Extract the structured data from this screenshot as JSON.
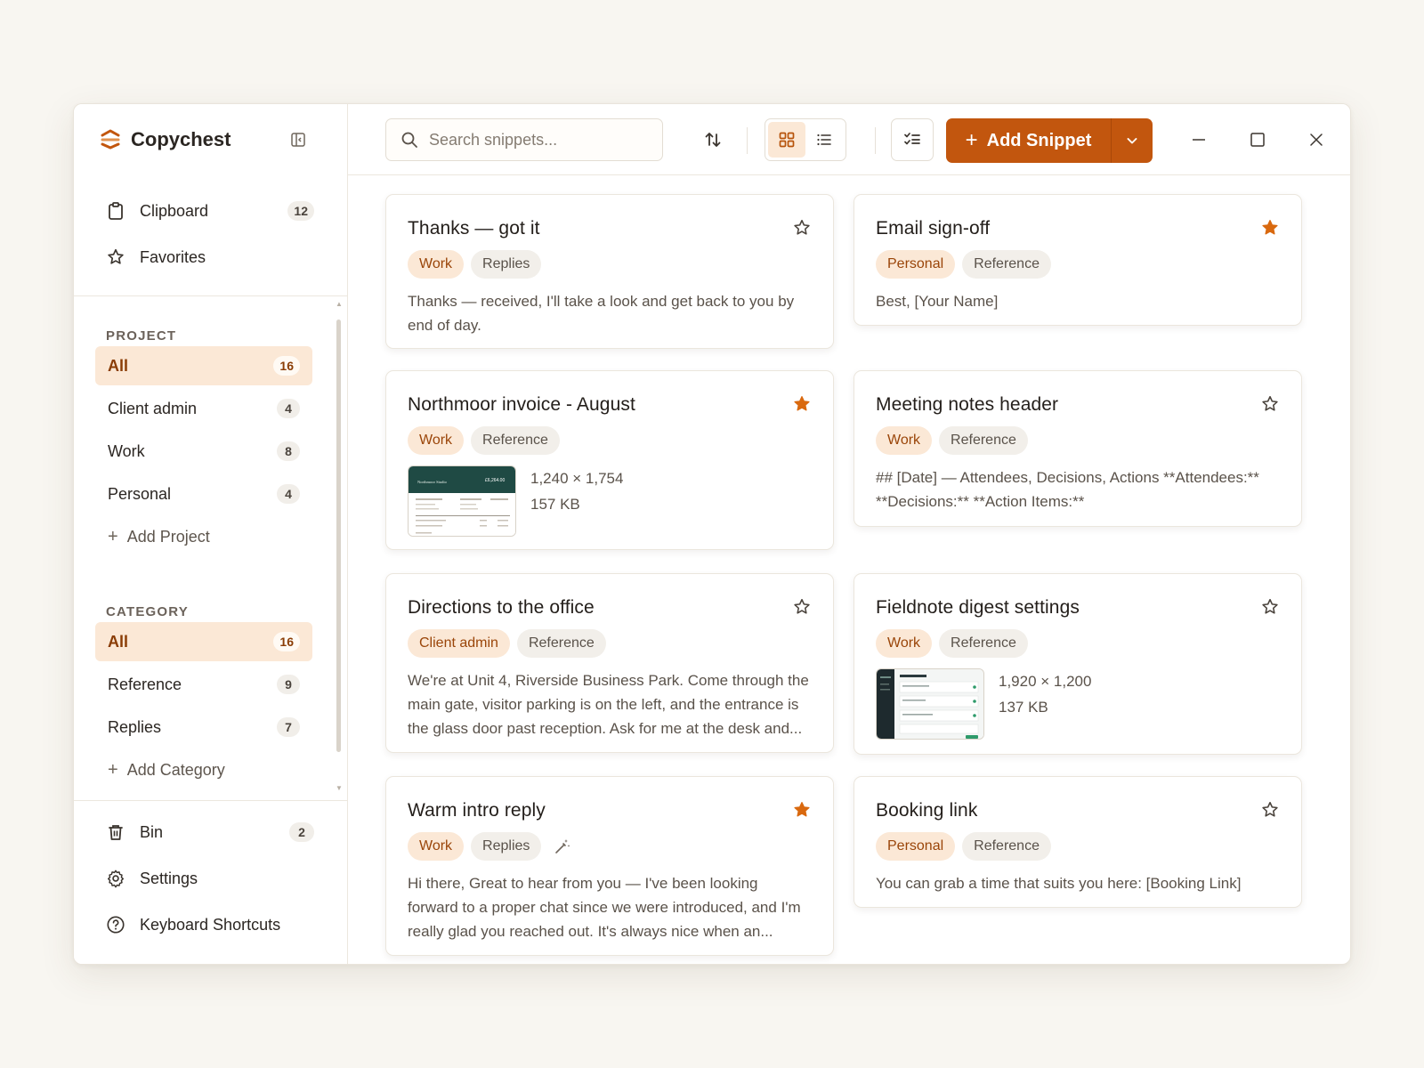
{
  "app": {
    "name": "Copychest"
  },
  "nav": {
    "clipboard": {
      "label": "Clipboard",
      "count": "12"
    },
    "favorites": {
      "label": "Favorites"
    }
  },
  "project": {
    "heading": "PROJECT",
    "items": [
      {
        "label": "All",
        "count": "16",
        "active": true
      },
      {
        "label": "Client admin",
        "count": "4"
      },
      {
        "label": "Work",
        "count": "8"
      },
      {
        "label": "Personal",
        "count": "4"
      }
    ],
    "add_label": "Add Project"
  },
  "category": {
    "heading": "CATEGORY",
    "items": [
      {
        "label": "All",
        "count": "16",
        "active": true
      },
      {
        "label": "Reference",
        "count": "9"
      },
      {
        "label": "Replies",
        "count": "7"
      }
    ],
    "add_label": "Add Category"
  },
  "bottom_nav": {
    "bin": {
      "label": "Bin",
      "count": "2"
    },
    "settings": {
      "label": "Settings"
    },
    "shortcuts": {
      "label": "Keyboard Shortcuts"
    }
  },
  "toolbar": {
    "search_placeholder": "Search snippets...",
    "search_value": "",
    "add_label": "Add Snippet",
    "view_mode": "grid"
  },
  "colors": {
    "accent": "#c2560e",
    "accent_soft": "#fbe8d6",
    "star_filled": "#d9690f"
  },
  "cards": [
    {
      "title": "Thanks — got it",
      "favorite": false,
      "tags": [
        "Work",
        "Replies"
      ],
      "text": "Thanks — received, I'll take a look and get back to you by end of day."
    },
    {
      "title": "Email sign-off",
      "favorite": true,
      "tags": [
        "Personal",
        "Reference"
      ],
      "text": "Best, [Your Name]"
    },
    {
      "title": "Northmoor invoice - August",
      "favorite": true,
      "tags": [
        "Work",
        "Reference"
      ],
      "image": {
        "dimensions": "1,240 × 1,754",
        "size": "157 KB",
        "thumb_header": "Northmoor Studio",
        "thumb_amount": "£6,264.00"
      }
    },
    {
      "title": "Meeting notes header",
      "favorite": false,
      "tags": [
        "Work",
        "Reference"
      ],
      "text": "## [Date] — Attendees, Decisions, Actions **Attendees:** **Decisions:** **Action Items:**"
    },
    {
      "title": "Directions to the office",
      "favorite": false,
      "tags": [
        "Client admin",
        "Reference"
      ],
      "text": "We're at Unit 4, Riverside Business Park. Come through the main gate, visitor parking is on the left, and the entrance is the glass door past reception. Ask for me at the desk and..."
    },
    {
      "title": "Fieldnote digest settings",
      "favorite": false,
      "tags": [
        "Work",
        "Reference"
      ],
      "image": {
        "dimensions": "1,920 × 1,200",
        "size": "137 KB"
      }
    },
    {
      "title": "Warm intro reply",
      "favorite": true,
      "tags": [
        "Work",
        "Replies"
      ],
      "ai_generated_icon": "magic-wand-icon",
      "text": "Hi there, Great to hear from you — I've been looking forward to a proper chat since we were introduced, and I'm really glad you reached out. It's always nice when an..."
    },
    {
      "title": "Booking link",
      "favorite": false,
      "tags": [
        "Personal",
        "Reference"
      ],
      "text": "You can grab a time that suits you here: [Booking Link]"
    }
  ]
}
